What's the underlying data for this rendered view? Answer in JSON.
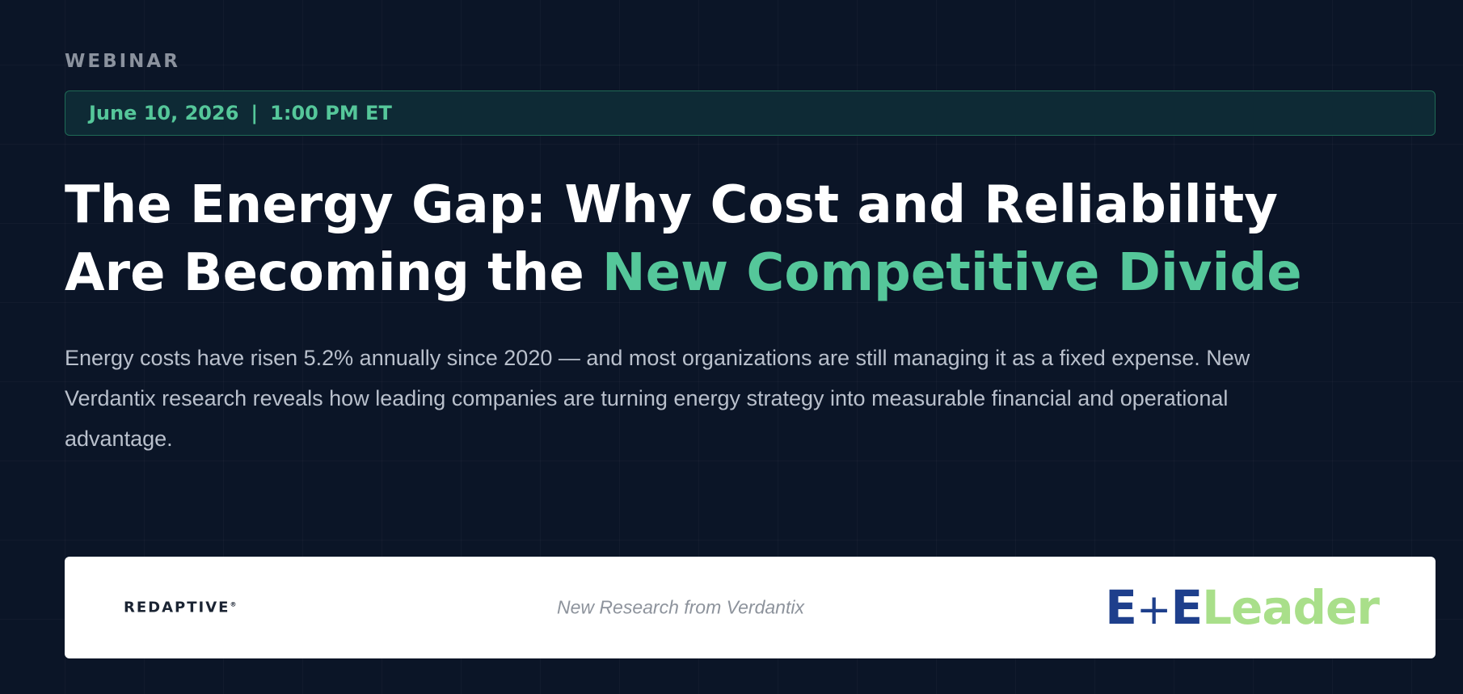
{
  "hero": {
    "eyebrow": "WEBINAR",
    "date": "June 10, 2026",
    "separator": "|",
    "time": "1:00 PM ET",
    "headline_line1": "The Energy Gap: Why Cost and Reliability",
    "headline_line2_start": "Are Becoming the ",
    "headline_line2_accent": "New Competitive Divide",
    "description": "Energy costs have risen 5.2% annually since 2020 — and most organizations are still managing it as a fixed expense. New Verdantix research reveals how leading companies are turning energy strategy into measurable financial and operational advantage."
  },
  "sponsor_bar": {
    "left_logo": "REDAPTIVE",
    "left_logo_mark": "®",
    "tagline": "New Research from Verdantix",
    "right_logo_e1": "E",
    "right_logo_plus": "+",
    "right_logo_e2": "E",
    "right_logo_leader": "Leader"
  },
  "colors": {
    "background": "#0b1527",
    "accent_green": "#55c79a",
    "date_bar_bg": "#0e2a35",
    "ee_blue": "#1e3f8c",
    "ee_green": "#a9df8a"
  }
}
